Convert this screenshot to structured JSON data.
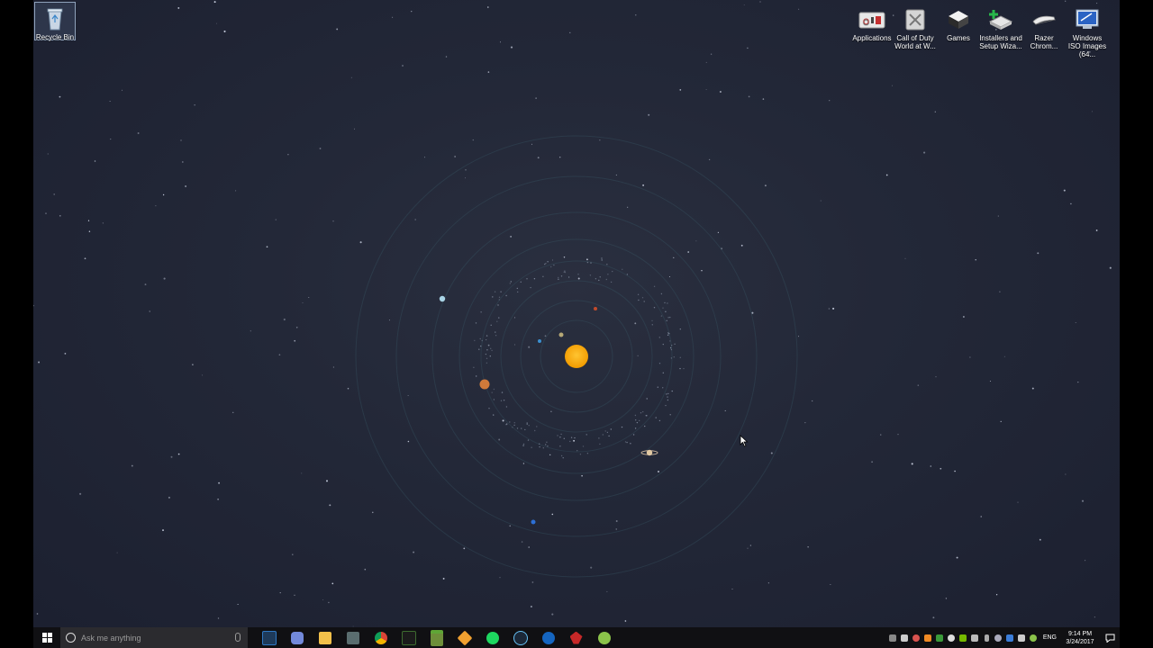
{
  "desktop": {
    "icons_left": [
      {
        "label": "Recycle Bin",
        "icon": "recycle-bin-icon"
      }
    ],
    "icons_right": [
      {
        "label": "Applications",
        "icon": "applications-folder-icon"
      },
      {
        "label": "Call of Duty World at W...",
        "icon": "call-of-duty-icon"
      },
      {
        "label": "Games",
        "icon": "steam-games-icon"
      },
      {
        "label": "Installers and Setup Wiza...",
        "icon": "installers-icon"
      },
      {
        "label": "Razer Chrom...",
        "icon": "razer-chroma-icon"
      },
      {
        "label": "Windows ISO Images (64...",
        "icon": "windows-iso-icon"
      }
    ]
  },
  "taskbar": {
    "search_placeholder": "Ask me anything",
    "pinned_apps": [
      "photoshop-icon",
      "discord-icon",
      "file-explorer-icon",
      "task-manager-icon",
      "chrome-icon",
      "terminal-icon",
      "minecraft-icon",
      "pinwheel-icon",
      "spotify-icon",
      "steam-icon",
      "browser-icon",
      "game-app-icon",
      "webtoon-icon"
    ],
    "tray_language": "ENG",
    "clock_time": "9:14 PM",
    "clock_date": "3/24/2017"
  },
  "colors": {
    "sun": "#f5a300",
    "taskbar_bg": "#101013",
    "orbit": "#3a5a66"
  }
}
